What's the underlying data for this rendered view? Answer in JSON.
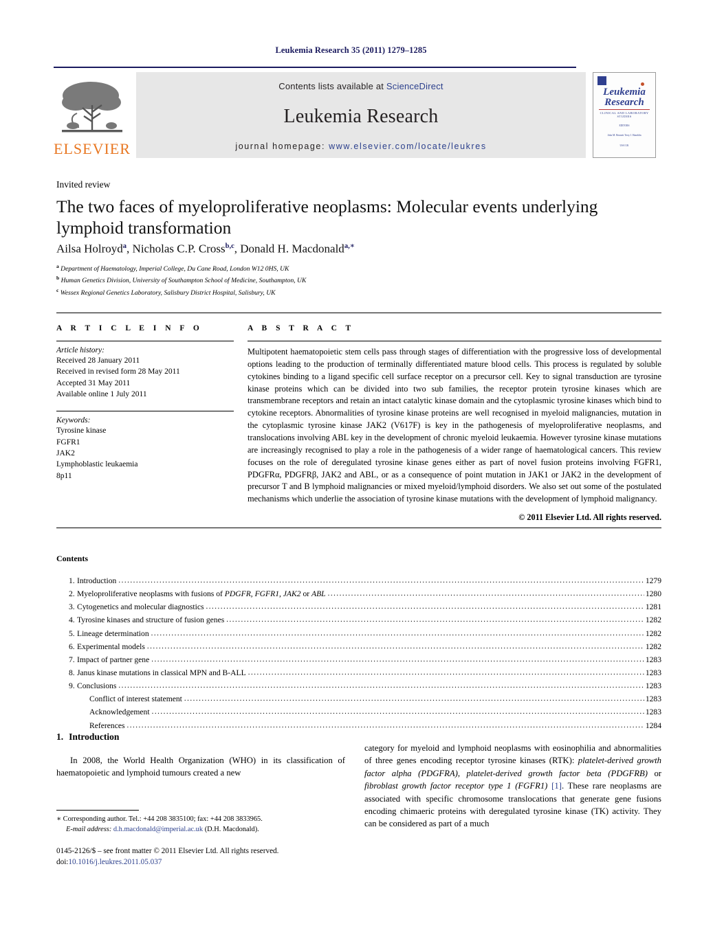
{
  "running_head": "Leukemia Research 35 (2011) 1279–1285",
  "masthead": {
    "contents_prefix": "Contents lists available at ",
    "sciencedirect": "ScienceDirect",
    "journal_name": "Leukemia Research",
    "homepage_prefix": "journal homepage: ",
    "homepage_url": "www.elsevier.com/locate/leukres",
    "publisher_wordmark": "ELSEVIER",
    "publisher_color": "#e87722",
    "link_color": "#2b3f8c",
    "cover": {
      "title_line1": "Leukemia",
      "title_line2": "Research",
      "subtitle": "CLINICAL AND LABORATORY STUDIES",
      "meta_label": "EDITORS",
      "meta_names": "John M. Bennett        Terry J. Hamblin",
      "meta_places": "USA                          UK"
    }
  },
  "article": {
    "type": "Invited review",
    "title": "The two faces of myeloproliferative neoplasms: Molecular events underlying lymphoid transformation",
    "authors_html": "Ailsa Holroyd<sup>a</sup>, Nicholas C.P. Cross<sup>b,c</sup>, Donald H. Macdonald<sup>a,∗</sup>",
    "affiliations": [
      {
        "marker": "a",
        "text": "Department of Haematology, Imperial College, Du Cane Road, London W12 0HS, UK"
      },
      {
        "marker": "b",
        "text": "Human Genetics Division, University of Southampton School of Medicine, Southampton, UK"
      },
      {
        "marker": "c",
        "text": "Wessex Regional Genetics Laboratory, Salisbury District Hospital, Salisbury, UK"
      }
    ]
  },
  "article_info": {
    "heading": "A R T I C L E   I N F O",
    "history_label": "Article history:",
    "history": [
      "Received 28 January 2011",
      "Received in revised form 28 May 2011",
      "Accepted 31 May 2011",
      "Available online 1 July 2011"
    ],
    "keywords_label": "Keywords:",
    "keywords": [
      "Tyrosine kinase",
      "FGFR1",
      "JAK2",
      "Lymphoblastic leukaemia",
      "8p11"
    ]
  },
  "abstract": {
    "heading": "A B S T R A C T",
    "text": "Multipotent haematopoietic stem cells pass through stages of differentiation with the progressive loss of developmental options leading to the production of terminally differentiated mature blood cells. This process is regulated by soluble cytokines binding to a ligand specific cell surface receptor on a precursor cell. Key to signal transduction are tyrosine kinase proteins which can be divided into two sub families, the receptor protein tyrosine kinases which are transmembrane receptors and retain an intact catalytic kinase domain and the cytoplasmic tyrosine kinases which bind to cytokine receptors. Abnormalities of tyrosine kinase proteins are well recognised in myeloid malignancies, mutation in the cytoplasmic tyrosine kinase JAK2 (V617F) is key in the pathogenesis of myeloproliferative neoplasms, and translocations involving ABL key in the development of chronic myeloid leukaemia. However tyrosine kinase mutations are increasingly recognised to play a role in the pathogenesis of a wider range of haematological cancers. This review focuses on the role of deregulated tyrosine kinase genes either as part of novel fusion proteins involving FGFR1, PDGFRα, PDGFRβ, JAK2 and ABL, or as a consequence of point mutation in JAK1 or JAK2 in the development of precursor T and B lymphoid malignancies or mixed myeloid/lymphoid disorders. We also set out some of the postulated mechanisms which underlie the association of tyrosine kinase mutations with the development of lymphoid malignancy.",
    "copyright": "© 2011 Elsevier Ltd. All rights reserved."
  },
  "contents": {
    "heading": "Contents",
    "items": [
      {
        "num": "1.",
        "label_html": "Introduction",
        "page": "1279",
        "sub": false
      },
      {
        "num": "2.",
        "label_html": "Myeloproliferative neoplasms with fusions of <i>PDGFR, FGFR1, JAK2</i> or <i>ABL</i>",
        "page": "1280",
        "sub": false
      },
      {
        "num": "3.",
        "label_html": "Cytogenetics and molecular diagnostics",
        "page": "1281",
        "sub": false
      },
      {
        "num": "4.",
        "label_html": "Tyrosine kinases and structure of fusion genes",
        "page": "1282",
        "sub": false
      },
      {
        "num": "5.",
        "label_html": "Lineage determination",
        "page": "1282",
        "sub": false
      },
      {
        "num": "6.",
        "label_html": "Experimental models",
        "page": "1282",
        "sub": false
      },
      {
        "num": "7.",
        "label_html": "Impact of partner gene",
        "page": "1283",
        "sub": false
      },
      {
        "num": "8.",
        "label_html": "Janus kinase mutations in classical MPN and B-ALL",
        "page": "1283",
        "sub": false
      },
      {
        "num": "9.",
        "label_html": "Conclusions",
        "page": "1283",
        "sub": false
      },
      {
        "num": "",
        "label_html": "Conflict of interest statement",
        "page": "1283",
        "sub": true
      },
      {
        "num": "",
        "label_html": "Acknowledgement",
        "page": "1283",
        "sub": true
      },
      {
        "num": "",
        "label_html": "References",
        "page": "1284",
        "sub": true
      }
    ]
  },
  "body": {
    "section_number": "1.",
    "section_title": "Introduction",
    "left_paragraph": "In 2008, the World Health Organization (WHO) in its classification of haematopoietic and lymphoid tumours created a new",
    "right_paragraph_html": "category for myeloid and lymphoid neoplasms with eosinophilia and abnormalities of three genes encoding receptor tyrosine kinases (RTK): <i>platelet-derived growth factor alpha (PDGFRA)</i>, <i>platelet-derived growth factor beta (PDGFRB)</i> or <i>fibroblast growth factor receptor type 1 (FGFR1)</i> <span class=\"ref-link\">[1]</span>. These rare neoplasms are associated with specific chromosome translocations that generate gene fusions encoding chimaeric proteins with deregulated tyrosine kinase (TK) activity. They can be considered as part of a much"
  },
  "footnote": {
    "marker": "∗",
    "corresponding": "Corresponding author. Tel.: +44 208 3835100; fax: +44 208 3833965.",
    "email_label": "E-mail address:",
    "email": "d.h.macdonald@imperial.ac.uk",
    "email_owner": "(D.H. Macdonald)."
  },
  "footer": {
    "issn_line": "0145-2126/$ – see front matter © 2011 Elsevier Ltd. All rights reserved.",
    "doi_prefix": "doi:",
    "doi": "10.1016/j.leukres.2011.05.037"
  }
}
